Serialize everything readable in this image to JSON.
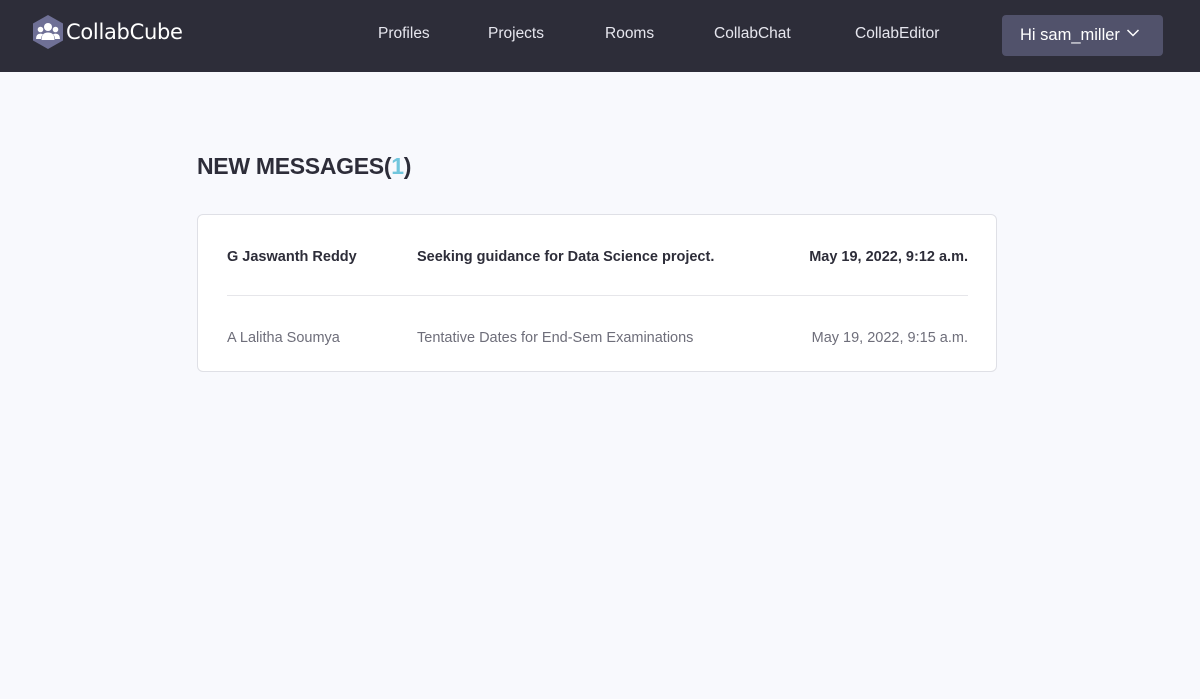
{
  "brand": {
    "name": "CollabCube"
  },
  "nav": {
    "links": [
      {
        "label": "Profiles"
      },
      {
        "label": "Projects"
      },
      {
        "label": "Rooms"
      },
      {
        "label": "CollabChat"
      },
      {
        "label": "CollabEditor"
      }
    ],
    "user_greeting": "Hi sam_miller"
  },
  "page": {
    "heading_text": "NEW MESSAGES",
    "open_paren": "(",
    "new_count": "1",
    "close_paren": ")"
  },
  "messages": [
    {
      "sender": "G Jaswanth Reddy",
      "subject": "Seeking guidance for Data Science project.",
      "date": "May 19, 2022, 9:12 a.m.",
      "unread": true
    },
    {
      "sender": "A Lalitha Soumya",
      "subject": "Tentative Dates for End-Sem Examinations",
      "date": "May 19, 2022, 9:15 a.m.",
      "unread": false
    }
  ],
  "colors": {
    "navbar_bg": "#2d2d39",
    "page_bg": "#f8f9fd",
    "user_button_bg": "#51526b",
    "count_accent": "#71c6dd",
    "text_dark": "#2d2d39",
    "text_muted": "#6e6e7a"
  }
}
